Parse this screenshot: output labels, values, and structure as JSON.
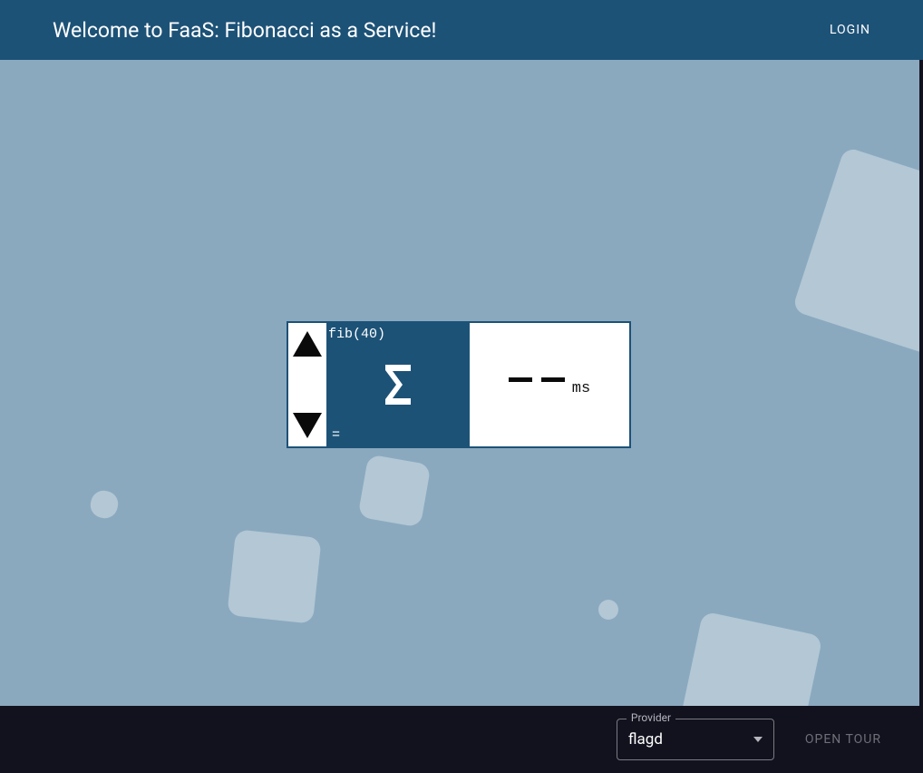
{
  "header": {
    "title": "Welcome to FaaS: Fibonacci as a Service!",
    "login_label": "LOGIN"
  },
  "calculator": {
    "fib_label": "fib(40)",
    "equals_label": "=",
    "result_value": "——",
    "ms_label": "ms"
  },
  "footer": {
    "provider_legend": "Provider",
    "provider_value": "flagd",
    "open_tour_label": "OPEN TOUR"
  },
  "icons": {
    "sigma": "sigma-icon",
    "up": "triangle-up-icon",
    "down": "triangle-down-icon",
    "caret": "caret-down-icon"
  }
}
